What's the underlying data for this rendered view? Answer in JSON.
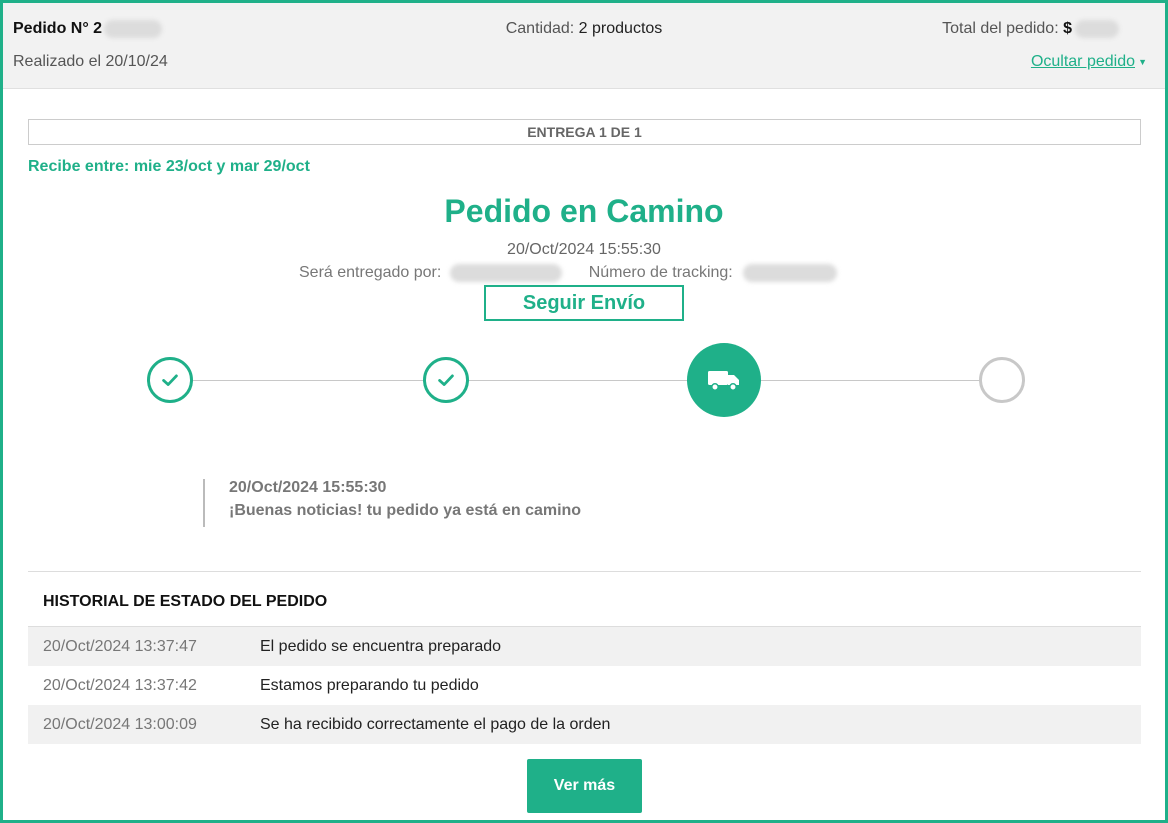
{
  "header": {
    "order_label": "Pedido N° 2",
    "placed": "Realizado el 20/10/24",
    "qty_label": "Cantidad:",
    "qty_value": "2 productos",
    "total_label": "Total del pedido:",
    "total_currency": "$",
    "hide_label": "Ocultar pedido",
    "hide_arrow": "▼"
  },
  "delivery": {
    "title": "ENTREGA 1 DE 1",
    "receive_window": "Recibe entre: mie 23/oct y mar 29/oct",
    "status": "Pedido en Camino",
    "status_datetime": "20/Oct/2024 15:55:30",
    "carrier_label": "Será entregado por:",
    "tracking_label": "Número de tracking:",
    "track_button": "Seguir Envío"
  },
  "stepper": {
    "steps": [
      {
        "state": "done",
        "icon": "check-icon"
      },
      {
        "state": "done",
        "icon": "check-icon"
      },
      {
        "state": "current",
        "icon": "truck-icon"
      },
      {
        "state": "pending",
        "icon": "empty-circle"
      }
    ]
  },
  "latest_event": {
    "datetime": "20/Oct/2024 15:55:30",
    "text": "¡Buenas noticias! tu pedido ya está en camino"
  },
  "history": {
    "title": "HISTORIAL DE ESTADO DEL PEDIDO",
    "rows": [
      {
        "datetime": "20/Oct/2024 13:37:47",
        "text": "El pedido se encuentra preparado"
      },
      {
        "datetime": "20/Oct/2024 13:37:42",
        "text": "Estamos preparando tu pedido"
      },
      {
        "datetime": "20/Oct/2024 13:00:09",
        "text": "Se ha recibido correctamente el pago de la orden"
      }
    ],
    "more_button": "Ver más"
  },
  "colors": {
    "accent": "#1fb089",
    "pending": "#c8c8c8",
    "header_bg": "#f2f2f2"
  }
}
